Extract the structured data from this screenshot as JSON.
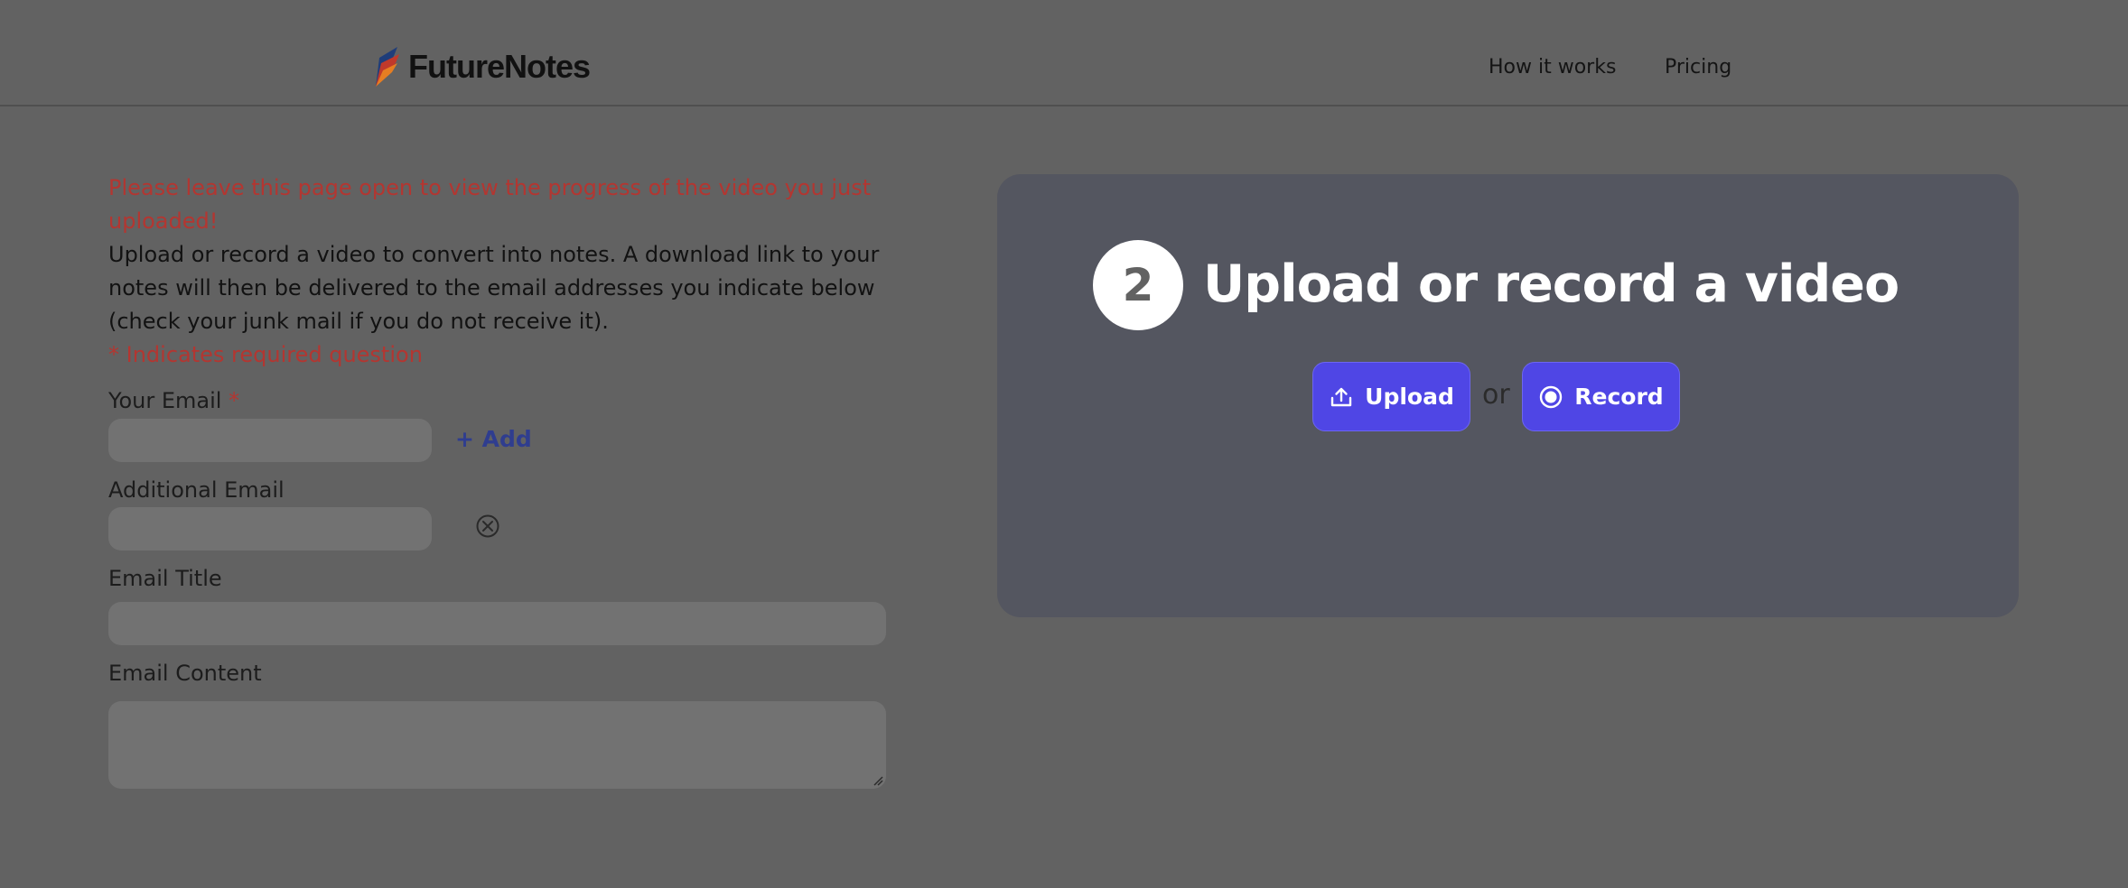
{
  "header": {
    "brand": "FutureNotes",
    "nav": [
      {
        "label": "How it works"
      },
      {
        "label": "Pricing"
      }
    ]
  },
  "form": {
    "notice": "Please leave this page open to view the progress of the video you just uploaded!",
    "instructions": "Upload or record a video to convert into notes. A download link to your notes will then be delivered to the email addresses you indicate below (check your junk mail if you do not receive it).",
    "required_note": "* Indicates required question",
    "your_email_label": "Your Email",
    "required_star": "*",
    "add_label": "+ Add",
    "additional_email_label": "Additional Email",
    "email_title_label": "Email Title",
    "email_content_label": "Email Content"
  },
  "card": {
    "step": "2",
    "title": "Upload or record a video",
    "upload_label": "Upload",
    "or_label": "or",
    "record_label": "Record"
  },
  "colors": {
    "background": "#626262",
    "accent": "#4f46e5",
    "notice_red": "#b33631",
    "card": "#545660"
  }
}
